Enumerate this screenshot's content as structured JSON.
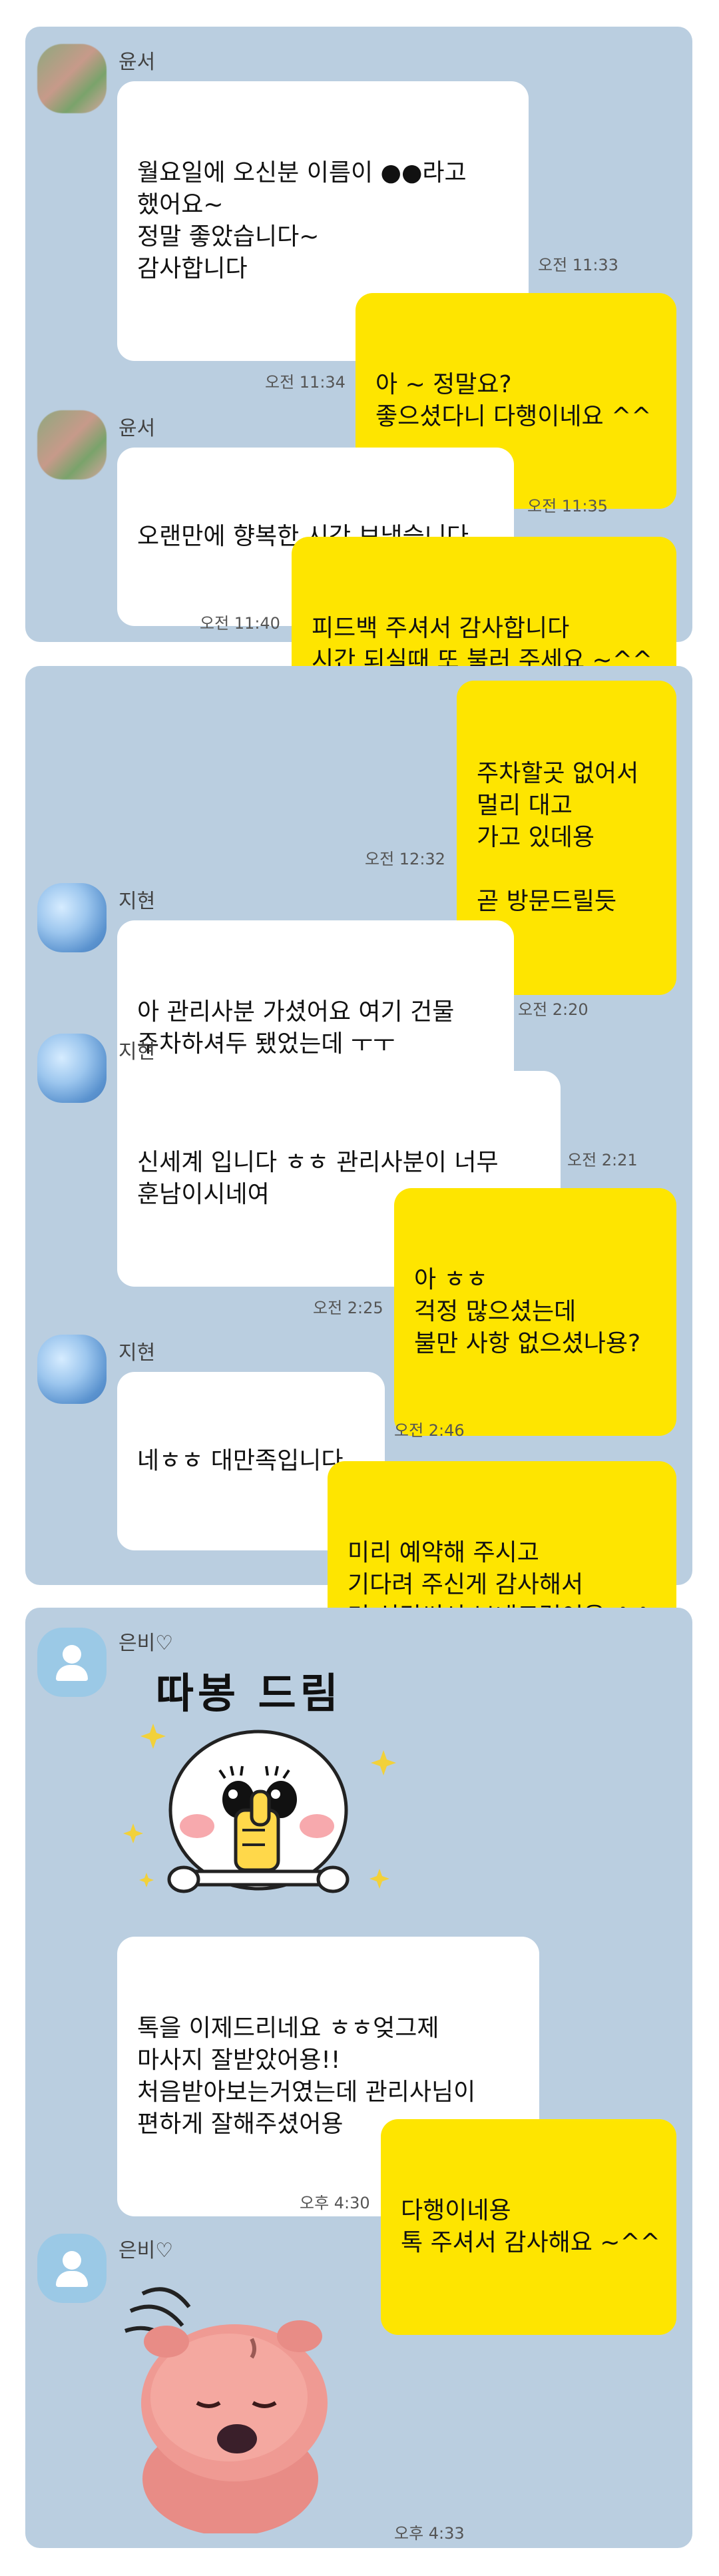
{
  "panels": [
    {
      "messages": [
        {
          "id": "m1",
          "sender": "윤서",
          "text": "월요일에 오신분 이름이 ●●라고\n했어요~\n정말 좋았습니다~\n감사합니다",
          "time": "오전 11:33"
        },
        {
          "id": "m2",
          "text": "아 ~ 정말요?\n좋으셨다니 다행이네요 ^^",
          "time": "오전 11:34"
        },
        {
          "id": "m3",
          "sender": "윤서",
          "text": "오랜만에 향복한 시간 보냈습니다",
          "time": "오전 11:35"
        },
        {
          "id": "m4",
          "text": "피드백 주셔서 감사합니다\n시간 되실때 또 불러 주세요 ~^^",
          "time": "오전 11:40"
        }
      ]
    },
    {
      "messages": [
        {
          "id": "m5",
          "text": "주차할곳 없어서\n멀리 대고\n가고 있데용\n\n곧 방문드릴듯",
          "time": "오전 12:32"
        },
        {
          "id": "m6",
          "sender": "지현",
          "text": "아 관리사분 가셨어요 여기 건물\n주차하셔두 됐었는데 ㅜㅜ",
          "time": "오전 2:20"
        },
        {
          "id": "m7",
          "sender": "지현",
          "text": "신세계 입니다 ㅎㅎ 관리사분이 너무\n훈남이시네여",
          "time": "오전 2:21"
        },
        {
          "id": "m8",
          "text": "아 ㅎㅎ\n걱정 많으셨는데\n불만 사항 없으셨나용?",
          "time": "오전 2:25"
        },
        {
          "id": "m9",
          "sender": "지현",
          "text": "네ㅎㅎ 대만족입니다",
          "time": "오전 2:46"
        },
        {
          "id": "m10",
          "text": "미리 예약해 주시고\n기다려 주신게 감사해서\n더 신경써서 보내드렸어용 ^^"
        }
      ]
    },
    {
      "messages": [
        {
          "id": "m11",
          "sender": "은비♡",
          "sticker_text": "따봉 드림",
          "sticker": "thumbs-up-sticker"
        },
        {
          "id": "m12",
          "text": "톡을 이제드리네요 ㅎㅎ엊그제\n마사지 잘받았어용!!\n처음받아보는거였는데 관리사님이\n편하게 잘해주셨어용"
        },
        {
          "id": "m13",
          "text": "다행이네용\n톡 주셔서 감사해요 ~^^",
          "time": "오후 4:30"
        },
        {
          "id": "m14",
          "sender": "은비♡",
          "sticker": "pink-creature-sticker",
          "time": "오후 4:33"
        }
      ]
    }
  ],
  "colors": {
    "background": "#bacee0",
    "bubble_in": "#ffffff",
    "bubble_out": "#fee500"
  }
}
